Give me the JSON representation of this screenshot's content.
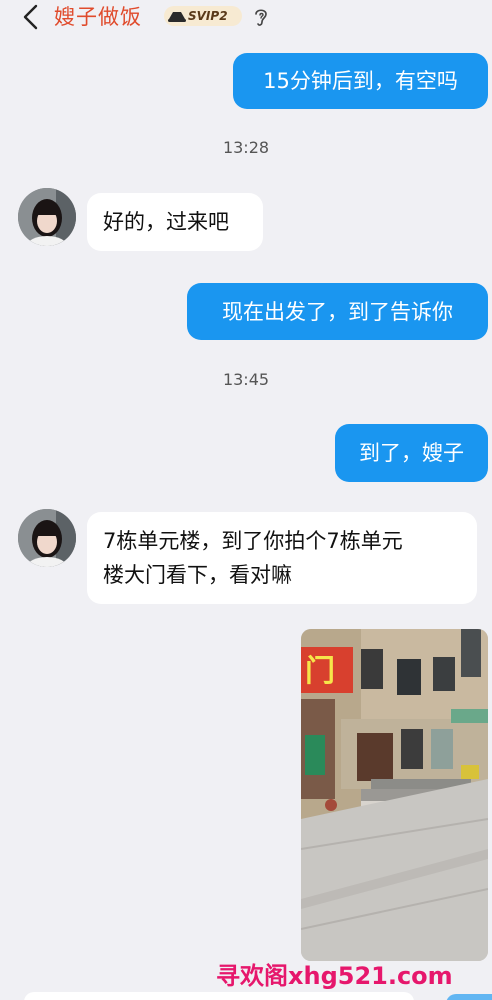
{
  "header": {
    "back_icon": "chevron-left-icon",
    "title": "嫂子做饭",
    "vip_label": "SVIP2",
    "vip_icon": "hat-icon",
    "ear_icon": "ear-icon",
    "title_color": "#e04b2c"
  },
  "messages": [
    {
      "side": "out",
      "text": "15分钟后到，有空吗"
    },
    {
      "type": "time",
      "text": "13:28"
    },
    {
      "side": "in",
      "text": "好的，过来吧"
    },
    {
      "side": "out",
      "text": "现在出发了，到了告诉你"
    },
    {
      "type": "time",
      "text": "13:45"
    },
    {
      "side": "out",
      "text": "到了，嫂子"
    },
    {
      "side": "in",
      "lines": [
        "7栋单元楼，到了你拍个7栋单元",
        "楼大门看下，看对嘛"
      ]
    },
    {
      "side": "out",
      "type": "image",
      "shop_sign_text": "门"
    }
  ],
  "watermark": "寻欢阁xhg521.com",
  "colors": {
    "outgoing_bubble": "#1a96f0",
    "incoming_bubble": "#ffffff",
    "background": "#f0f0f4",
    "watermark": "#e6176c"
  }
}
